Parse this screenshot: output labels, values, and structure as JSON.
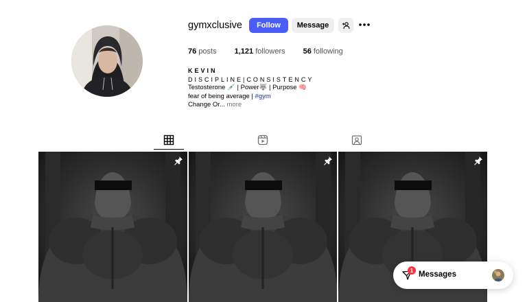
{
  "profile": {
    "username": "gymxclusive",
    "follow_label": "Follow",
    "message_label": "Message",
    "stats": {
      "posts_count": "76",
      "posts_label": "posts",
      "followers_count": "1,121",
      "followers_label": "followers",
      "following_count": "56",
      "following_label": "following"
    },
    "bio": {
      "name": "KEVIN",
      "line1": "DISCIPLINE|CONSISTENCY",
      "line2_a": "Testosterone ",
      "line2_emoji1": "💉",
      "line2_b": " | Power",
      "line2_emoji2": "🐺",
      "line2_c": " | Purpose ",
      "line2_emoji3": "🧠",
      "line3_a": "fear of being average | ",
      "line3_tag": "#gym",
      "line4": "Change Or...",
      "more_label": " more"
    }
  },
  "tabs": [
    "posts-grid-icon",
    "reels-icon",
    "tagged-icon"
  ],
  "messages": {
    "label": "Messages",
    "badge": "1"
  },
  "colors": {
    "accent": "#4a5df9",
    "badge": "#ff3040",
    "button_bg": "#efefef"
  }
}
